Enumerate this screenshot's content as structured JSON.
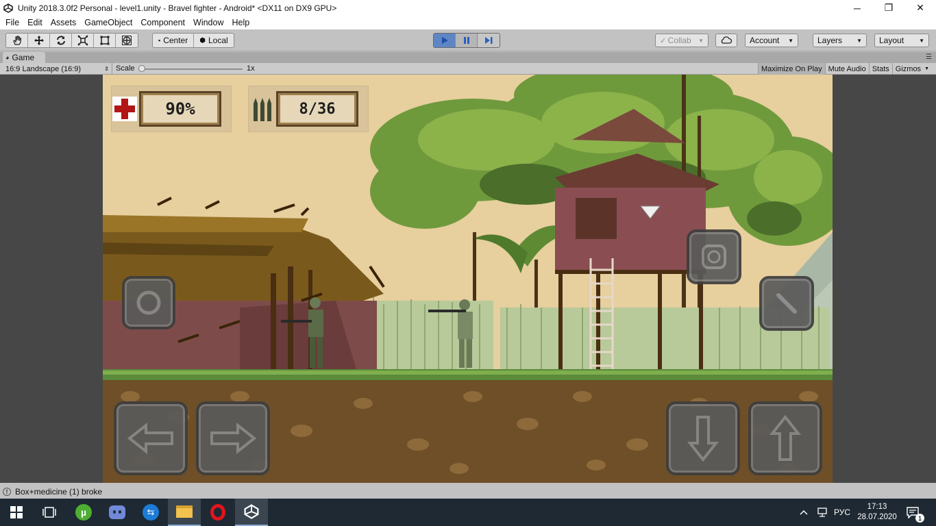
{
  "window": {
    "title": "Unity 2018.3.0f2 Personal - level1.unity - Bravel fighter - Android* <DX11 on DX9 GPU>",
    "minimize": "─",
    "maximize": "❐",
    "close": "✕"
  },
  "menu": [
    "File",
    "Edit",
    "Assets",
    "GameObject",
    "Component",
    "Window",
    "Help"
  ],
  "toolbar": {
    "tools": [
      "hand-tool",
      "move-tool",
      "rotate-tool",
      "scale-tool",
      "rect-tool",
      "transform-tool"
    ],
    "pivot_center": "Center",
    "pivot_local": "Local",
    "collab": "Collab",
    "account": "Account",
    "layers": "Layers",
    "layout": "Layout"
  },
  "game_tab": {
    "label": "Game",
    "aspect": "16:9 Landscape (16:9)",
    "scale_label": "Scale",
    "scale_value": "1x",
    "toggles": [
      "Maximize On Play",
      "Mute Audio",
      "Stats",
      "Gizmos"
    ]
  },
  "hud": {
    "health": "90%",
    "ammo": "8/36"
  },
  "colors": {
    "sky": "#e7cf9e",
    "play_active": "#5e86c4",
    "taskbar": "#1e2933"
  },
  "status": {
    "message": "Box+medicine (1) broke"
  },
  "taskbar": {
    "apps": [
      "windows-start",
      "task-view",
      "utorrent",
      "discord",
      "teamviewer",
      "file-explorer",
      "opera",
      "unity"
    ],
    "lang": "РУС",
    "time": "17:13",
    "date": "28.07.2020"
  }
}
